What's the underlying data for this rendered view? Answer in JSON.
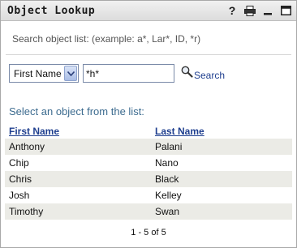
{
  "window": {
    "title": "Object Lookup",
    "icons": [
      "help-icon",
      "print-icon",
      "minimize-icon",
      "maximize-icon"
    ],
    "help_glyph": "?"
  },
  "search": {
    "hint": "Search object list: (example: a*, Lar*, ID, *r)",
    "attribute_selected": "First Name",
    "query_value": "*h*",
    "button_label": "Search"
  },
  "results": {
    "prompt": "Select an object from the list:",
    "columns": [
      "First Name",
      "Last Name"
    ],
    "rows": [
      {
        "first": "Anthony",
        "last": "Palani"
      },
      {
        "first": "Chip",
        "last": "Nano"
      },
      {
        "first": "Chris",
        "last": "Black"
      },
      {
        "first": "Josh",
        "last": "Kelley"
      },
      {
        "first": "Timothy",
        "last": "Swan"
      }
    ],
    "pager": "1 - 5 of 5"
  },
  "colors": {
    "link": "#1f3f8f",
    "prompt": "#3c6b8f",
    "row_shade": "#ebebe6"
  }
}
